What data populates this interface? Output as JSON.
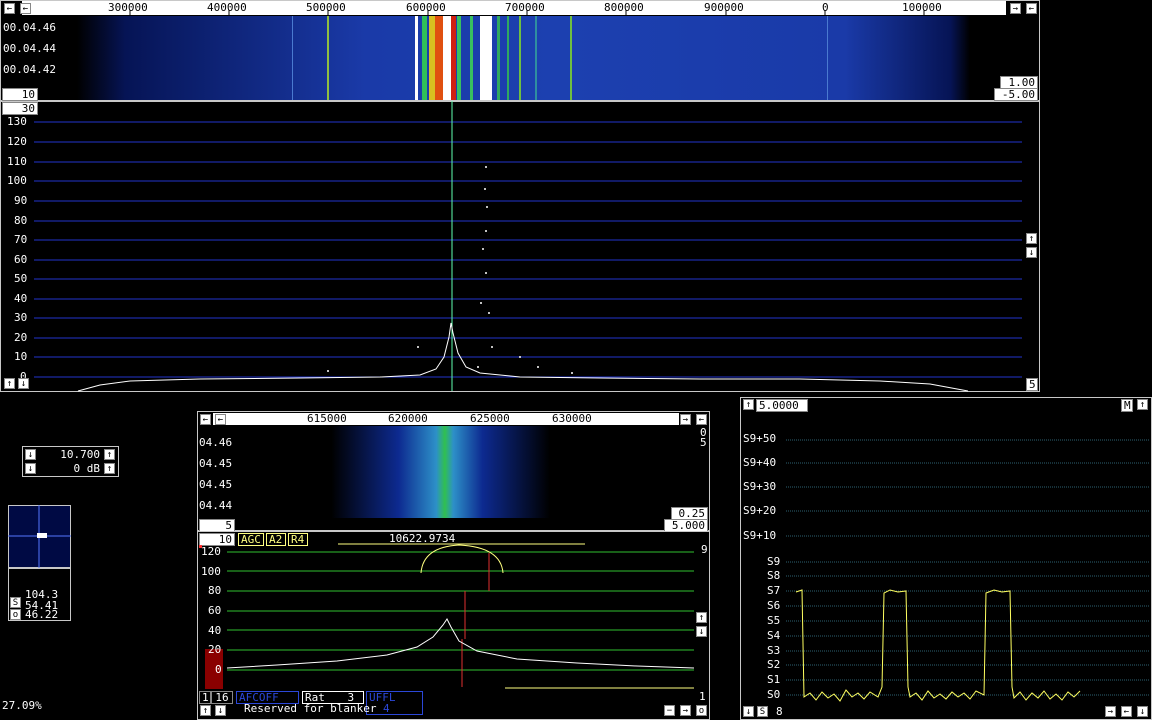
{
  "main_waterfall": {
    "freq_labels": [
      "300000",
      "400000",
      "500000",
      "600000",
      "700000",
      "800000",
      "900000",
      "0",
      "100000"
    ],
    "time_labels": [
      "00.04.46",
      "00.04.44",
      "00.04.42"
    ],
    "avg_value": "10",
    "gain_value": "1.00",
    "offset_value": "-5.00"
  },
  "main_spectrum": {
    "top_value": "30",
    "y_labels": [
      "130",
      "120",
      "110",
      "100",
      "90",
      "80",
      "70",
      "60",
      "50",
      "40",
      "30",
      "20",
      "10",
      "0"
    ],
    "right_value": "5"
  },
  "left_panel": {
    "bfo_value": "10.700",
    "att_value": "0 dB",
    "meter_a": "104.3",
    "meter_b": "54.41",
    "meter_c": "46.22",
    "meter_s_label": "S",
    "meter_o_label": "o",
    "cpu_load": "27.09%"
  },
  "baseband": {
    "freq_labels": [
      "615000",
      "620000",
      "625000",
      "630000"
    ],
    "time_labels": [
      "04.46",
      "04.45",
      "04.45",
      "04.44"
    ],
    "right_top_a": "0",
    "right_top_b": "5",
    "avg_value": "5",
    "gain_value": "0.25",
    "offset_value": "5.000",
    "spec_avg": "10",
    "agc_label": "AGC",
    "a2_label": "A2",
    "r4_label": "R4",
    "freq_readout": "10622.9734",
    "right_num": "9",
    "y_labels": [
      "120",
      "100",
      "80",
      "60",
      "40",
      "20",
      "0"
    ],
    "bottom_right_num": "1",
    "bottom_left_a": "1",
    "bottom_left_b": "16",
    "afc_label": "AFCOFF",
    "rat_label": "Rat",
    "rat_value": "3",
    "ufm_label": "UFFL",
    "ufm_value": "4",
    "status_text": "Reserved for blanker"
  },
  "s_meter": {
    "top_value": "5.0000",
    "m_label": "M",
    "labels": [
      "S9+50",
      "S9+40",
      "S9+30",
      "S9+20",
      "S9+10",
      "S9",
      "S8",
      "S7",
      "S6",
      "S5",
      "S4",
      "S3",
      "S2",
      "S1",
      "S0"
    ],
    "bottom_s": "S",
    "bottom_val": "8"
  }
}
